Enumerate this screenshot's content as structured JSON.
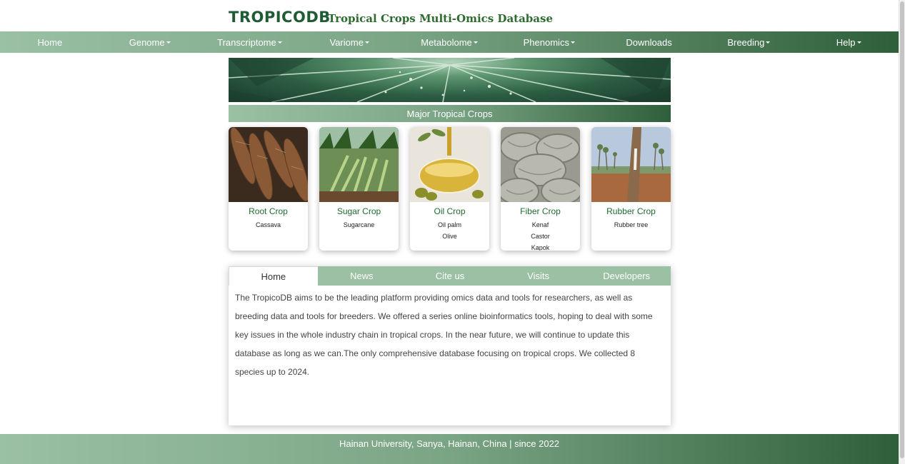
{
  "header": {
    "logo": "TROPICODB",
    "subtitle": "Tropical Crops Multi-Omics Database"
  },
  "nav": {
    "items": [
      {
        "label": "Home",
        "dropdown": false
      },
      {
        "label": "Genome",
        "dropdown": true
      },
      {
        "label": "Transcriptome",
        "dropdown": true
      },
      {
        "label": "Variome",
        "dropdown": true
      },
      {
        "label": "Metabolome",
        "dropdown": true
      },
      {
        "label": "Phenomics",
        "dropdown": true
      },
      {
        "label": "Downloads",
        "dropdown": false
      },
      {
        "label": "Breeding",
        "dropdown": true
      },
      {
        "label": "Help",
        "dropdown": true
      }
    ]
  },
  "section_title": "Major Tropical Crops",
  "crops": [
    {
      "title": "Root Crop",
      "species": [
        "Cassava"
      ],
      "image": "cassava-roots-image"
    },
    {
      "title": "Sugar Crop",
      "species": [
        "Sugarcane"
      ],
      "image": "sugarcane-image"
    },
    {
      "title": "Oil Crop",
      "species": [
        "Oil palm",
        "Olive"
      ],
      "image": "olive-oil-image"
    },
    {
      "title": "Fiber Crop",
      "species": [
        "Kenaf",
        "Castor",
        "Kapok"
      ],
      "image": "rope-fiber-image"
    },
    {
      "title": "Rubber Crop",
      "species": [
        "Rubber tree"
      ],
      "image": "rubber-tree-image"
    }
  ],
  "tabs": {
    "items": [
      "Home",
      "News",
      "Cite us",
      "Visits",
      "Developers"
    ],
    "active": "Home",
    "content": "The TropicoDB aims to be the leading platform providing omics data and tools for researchers, as well as breeding data and tools for breeders. We offered a series online bioinformatics tools, hoping to deal with some key issues in the whole industry chain in tropical crops. In the near future, we will continue to update this database as long as we can.The only comprehensive database focusing on tropical crops. We collected 8 species up to 2024."
  },
  "footer": {
    "text": "Hainan University, Sanya, Hainan, China | since 2022"
  },
  "colors": {
    "brand_green": "#1f5b34",
    "nav_light": "#9bc0a4",
    "nav_dark": "#2f5f3a",
    "card_title": "#1f6b2f"
  }
}
